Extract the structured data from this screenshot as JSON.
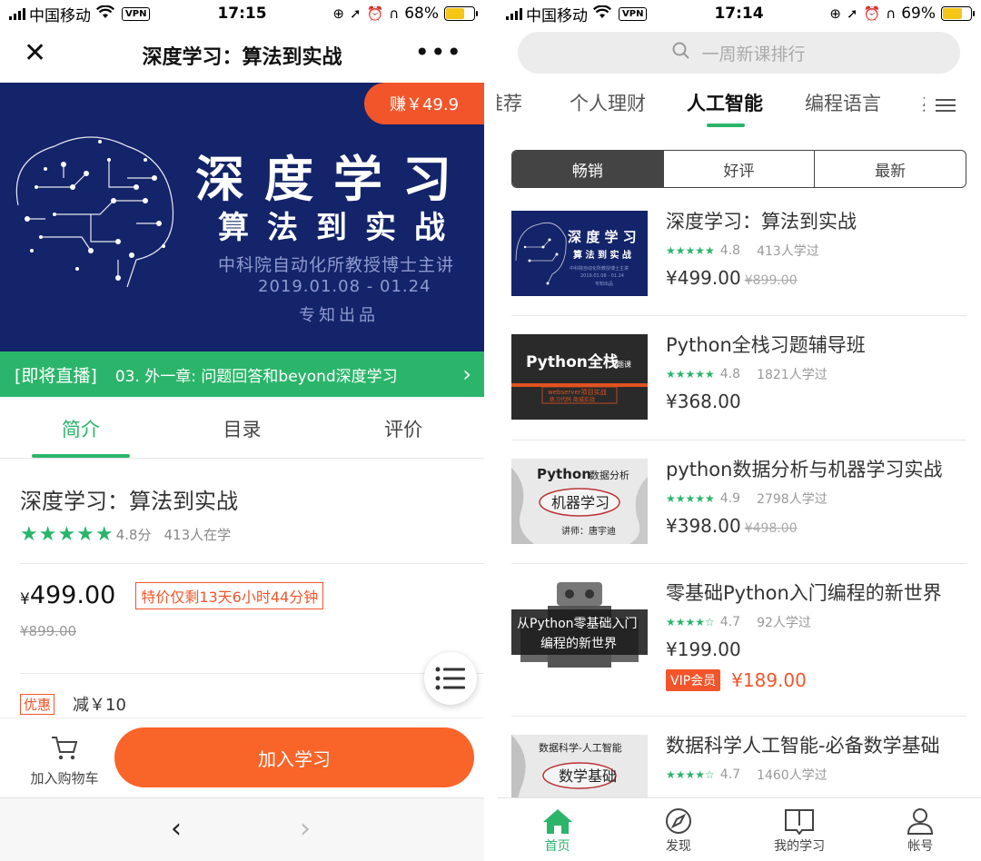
{
  "colors": {
    "accent": "#2bb56b",
    "orange": "#f96429",
    "banner_bg": "#14246a"
  },
  "left": {
    "status": {
      "carrier": "中国移动",
      "vpn": "VPN",
      "time": "17:15",
      "battery": "68%",
      "battery_level": 0.68
    },
    "header": {
      "close_icon": "close-icon",
      "title": "深度学习：算法到实战",
      "more_icon": "more-icon"
    },
    "banner": {
      "earn": "赚￥49.9",
      "line1": "深度学习",
      "line2": "算法到实战",
      "line3": "中科院自动化所教授博士主讲",
      "line4": "2019.01.08 - 01.24",
      "line5": "专知出品"
    },
    "live": {
      "tag": "[即将直播]",
      "text": "03. 外一章: 问题回答和beyond深度学习",
      "arrow": "›"
    },
    "tabs": [
      "简介",
      "目录",
      "评价"
    ],
    "course": {
      "title": "深度学习：算法到实战",
      "stars": "★★★★★",
      "score": "4.8分",
      "learners": "413人在学",
      "yen": "¥",
      "price": "499.00",
      "promo": "特价仅剩13天6小时44分钟",
      "original_price": "¥899.00",
      "coupon_tag": "优惠",
      "coupon_text": "减￥10"
    },
    "bottom": {
      "cart_label": "加入购物车",
      "join_label": "加入学习"
    },
    "nav": {
      "back": "‹",
      "forward": "›"
    }
  },
  "right": {
    "status": {
      "carrier": "中国移动",
      "vpn": "VPN",
      "time": "17:14",
      "battery": "69%",
      "battery_level": 0.69
    },
    "search": {
      "placeholder": "一周新课排行"
    },
    "tabs": [
      "推荐",
      "个人理财",
      "人工智能",
      "编程语言",
      "办"
    ],
    "segments": [
      "畅销",
      "好评",
      "最新"
    ],
    "courses": [
      {
        "title": "深度学习：算法到实战",
        "stars": "★★★★★",
        "rating": "4.8",
        "learners": "413人学过",
        "price": "¥499.00",
        "original": "¥899.00",
        "thumb": {
          "l1": "深 度 学 习",
          "l2": "算 法 到 实 战",
          "l3": "中科院自动化所教授博士主讲",
          "l4": "2019.01.08 - 01.24",
          "l5": "专知出品"
        }
      },
      {
        "title": "Python全栈习题辅导班",
        "stars": "★★★★★",
        "rating": "4.8",
        "learners": "1821人学过",
        "price": "¥368.00",
        "original": "",
        "thumb": {
          "l1": "Python全栈",
          "l1b": "习题课",
          "l2": "webserver项目实战",
          "l3": "练习代码 商城实战"
        }
      },
      {
        "title": "python数据分析与机器学习实战",
        "stars": "★★★★★",
        "rating": "4.9",
        "learners": "2798人学过",
        "price": "¥398.00",
        "original": "¥498.00",
        "thumb": {
          "l1": "Python",
          "l1b": "数据分析",
          "l2": "机器学习",
          "l3": "讲师：唐宇迪"
        }
      },
      {
        "title": "零基础Python入门编程的新世界",
        "stars": "★★★★☆",
        "rating": "4.7",
        "learners": "92人学过",
        "price": "¥199.00",
        "original": "",
        "vip_tag": "VIP会员",
        "vip_price": "¥189.00",
        "thumb": {
          "l1": "从Python零基础入门",
          "l2": "编程的新世界"
        }
      },
      {
        "title": "数据科学人工智能-必备数学基础",
        "stars": "★★★★☆",
        "rating": "4.7",
        "learners": "1460人学过",
        "price": "",
        "original": "",
        "thumb": {
          "l1": "数据科学-人工智能",
          "l2": "数学基础"
        }
      }
    ],
    "tabbar": [
      {
        "label": "首页",
        "icon": "home-icon"
      },
      {
        "label": "发现",
        "icon": "compass-icon"
      },
      {
        "label": "我的学习",
        "icon": "book-icon"
      },
      {
        "label": "帐号",
        "icon": "user-icon"
      }
    ]
  }
}
